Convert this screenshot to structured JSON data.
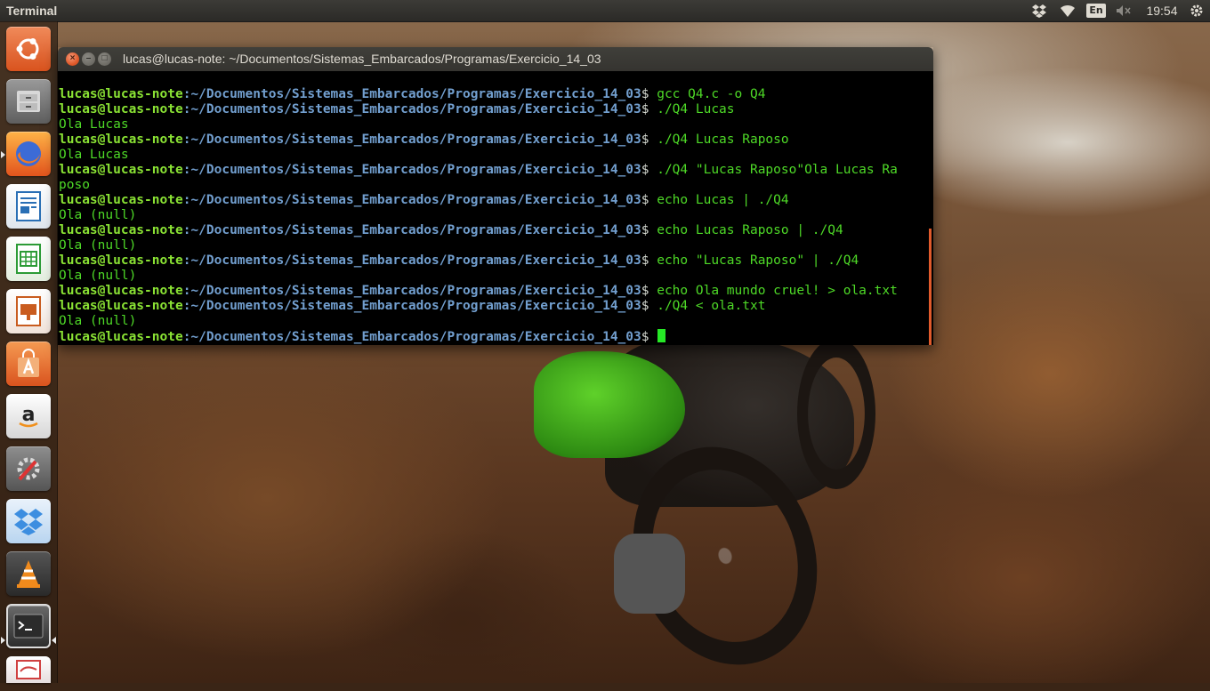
{
  "panel": {
    "app_title": "Terminal",
    "language": "En",
    "clock": "19:54"
  },
  "icons": {
    "dropbox": "dropbox-icon",
    "wifi": "wifi-icon",
    "sound": "sound-muted-icon",
    "settings": "gear-icon"
  },
  "launcher": [
    {
      "name": "ubuntu-dash",
      "color": "#e05a2b"
    },
    {
      "name": "files",
      "color": "#8a8a8a"
    },
    {
      "name": "firefox",
      "color": "#e66a1c"
    },
    {
      "name": "libreoffice-writer",
      "color": "#2a6fb5"
    },
    {
      "name": "libreoffice-calc",
      "color": "#2c9b36"
    },
    {
      "name": "libreoffice-impress",
      "color": "#c95c1f"
    },
    {
      "name": "software-center",
      "color": "#e06a2a"
    },
    {
      "name": "amazon",
      "color": "#e8e8e8"
    },
    {
      "name": "system-settings",
      "color": "#7a7a7a"
    },
    {
      "name": "dropbox",
      "color": "#3d8ee0"
    },
    {
      "name": "vlc",
      "color": "#f08a1c"
    },
    {
      "name": "terminal",
      "color": "#2d2d2d"
    },
    {
      "name": "text-editor",
      "color": "#d04040"
    }
  ],
  "window": {
    "title": "lucas@lucas-note: ~/Documentos/Sistemas_Embarcados/Programas/Exercicio_14_03"
  },
  "terminal": {
    "prompt_user": "lucas@lucas-note",
    "prompt_path": ":~/Documentos/Sistemas_Embarcados/Programas/Exercicio_14_03",
    "prompt_symbol": "$",
    "lines": [
      {
        "type": "prompt",
        "cmd": " gcc Q4.c -o Q4"
      },
      {
        "type": "prompt",
        "cmd": " ./Q4 Lucas"
      },
      {
        "type": "output",
        "text": "Ola Lucas"
      },
      {
        "type": "prompt",
        "cmd": " ./Q4 Lucas Raposo"
      },
      {
        "type": "output",
        "text": "Ola Lucas"
      },
      {
        "type": "prompt",
        "cmd": " ./Q4 \"Lucas Raposo\"Ola Lucas Ra"
      },
      {
        "type": "output",
        "text": "poso"
      },
      {
        "type": "prompt",
        "cmd": " echo Lucas | ./Q4"
      },
      {
        "type": "output",
        "text": "Ola (null)"
      },
      {
        "type": "prompt",
        "cmd": " echo Lucas Raposo | ./Q4"
      },
      {
        "type": "output",
        "text": "Ola (null)"
      },
      {
        "type": "prompt",
        "cmd": " echo \"Lucas Raposo\" | ./Q4"
      },
      {
        "type": "output",
        "text": "Ola (null)"
      },
      {
        "type": "prompt",
        "cmd": " echo Ola mundo cruel! > ola.txt"
      },
      {
        "type": "prompt",
        "cmd": " ./Q4 < ola.txt"
      },
      {
        "type": "output",
        "text": "Ola (null)"
      },
      {
        "type": "prompt",
        "cmd": " ",
        "cursor": true
      }
    ]
  }
}
